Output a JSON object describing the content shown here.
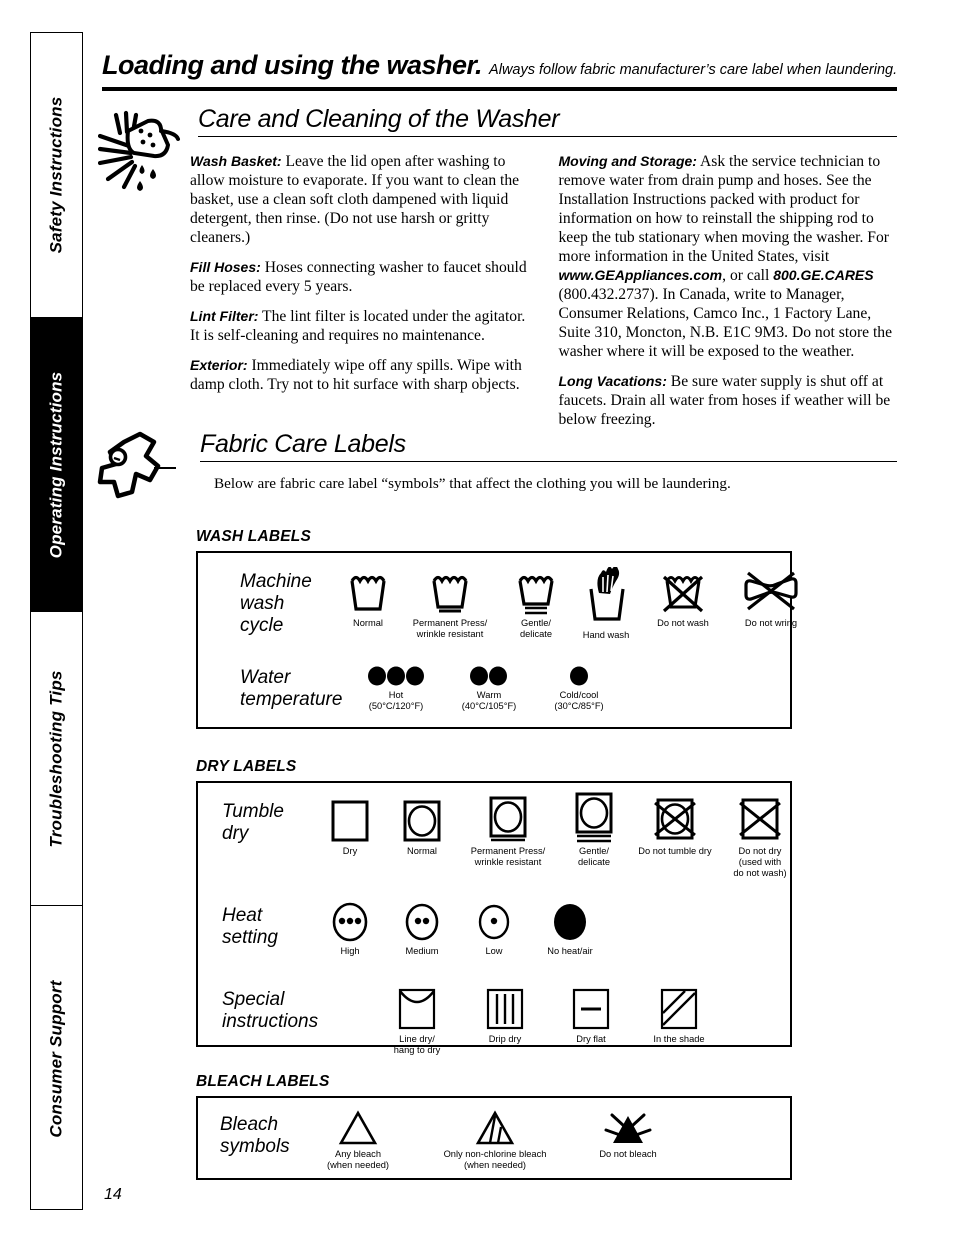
{
  "sidebar": {
    "tabs": [
      {
        "label": "Safety Instructions",
        "active": false
      },
      {
        "label": "Operating Instructions",
        "active": true
      },
      {
        "label": "Troubleshooting Tips",
        "active": false
      },
      {
        "label": "Consumer Support",
        "active": false
      }
    ]
  },
  "header": {
    "title": "Loading and using the washer.",
    "subtitle": "Always follow fabric manufacturer’s care label when laundering."
  },
  "care_section": {
    "heading": "Care and Cleaning of the Washer",
    "icon": "sponge-drip-icon",
    "left_column": [
      {
        "lead": "Wash Basket:",
        "text": " Leave the lid open after washing to allow moisture to evaporate. If you want to clean the basket, use a clean soft cloth dampened with liquid detergent, then rinse. (Do not use harsh or gritty cleaners.)"
      },
      {
        "lead": "Fill Hoses:",
        "text": " Hoses connecting washer to faucet should be replaced every 5 years."
      },
      {
        "lead": "Lint Filter:",
        "text": " The lint filter is located under the agitator. It is self-cleaning and requires no maintenance."
      },
      {
        "lead": "Exterior:",
        "text": " Immediately wipe off any spills. Wipe with damp cloth. Try not to hit surface with sharp objects."
      }
    ],
    "right_column": {
      "moving_lead": "Moving and Storage:",
      "moving_part1": " Ask the service technician to remove water from drain pump and hoses. See the Installation Instructions packed with product for information on how to reinstall the shipping rod to keep the tub stationary when moving the washer. For more information in the United States, visit ",
      "website": "www.GEAppliances.com",
      "moving_part2": ", or call ",
      "phone_word": "800.GE.CARES",
      "moving_part3": " (800.432.2737). In Canada, write to Manager, Consumer Relations, Camco Inc., 1 Factory Lane, Suite 310, Moncton, N.B. E1C 9M3. Do not store the washer where it will be exposed to the weather.",
      "vacation_lead": "Long Vacations:",
      "vacation_text": " Be sure water supply is shut off at faucets. Drain all water from hoses if weather will be below freezing."
    }
  },
  "fabric_section": {
    "heading": "Fabric Care Labels",
    "icon": "garment-person-icon",
    "intro": "Below are fabric care label “symbols” that affect the clothing you will be laundering."
  },
  "wash_labels": {
    "title": "WASH LABELS",
    "rows": [
      {
        "label": "Machine\nwash\ncycle",
        "symbols": [
          {
            "icon": "wash-tub-normal-icon",
            "caption": "Normal"
          },
          {
            "icon": "wash-tub-permanent-press-icon",
            "caption": "Permanent Press/\nwrinkle resistant"
          },
          {
            "icon": "wash-tub-gentle-icon",
            "caption": "Gentle/\ndelicate"
          },
          {
            "icon": "hand-wash-icon",
            "caption": "Hand wash"
          },
          {
            "icon": "do-not-wash-icon",
            "caption": "Do not wash"
          },
          {
            "icon": "do-not-wring-icon",
            "caption": "Do not wring"
          }
        ]
      },
      {
        "label": "Water\ntemperature",
        "symbols": [
          {
            "icon": "three-dots-icon",
            "caption": "Hot\n(50°C/120°F)"
          },
          {
            "icon": "two-dots-icon",
            "caption": "Warm\n(40°C/105°F)"
          },
          {
            "icon": "one-dot-icon",
            "caption": "Cold/cool\n(30°C/85°F)"
          }
        ]
      }
    ]
  },
  "dry_labels": {
    "title": "DRY LABELS",
    "rows": [
      {
        "label": "Tumble\ndry",
        "symbols": [
          {
            "icon": "square-dry-icon",
            "caption": "Dry"
          },
          {
            "icon": "tumble-dry-normal-icon",
            "caption": "Normal"
          },
          {
            "icon": "tumble-dry-permanent-press-icon",
            "caption": "Permanent Press/\nwrinkle resistant"
          },
          {
            "icon": "tumble-dry-gentle-icon",
            "caption": "Gentle/\ndelicate"
          },
          {
            "icon": "do-not-tumble-dry-icon",
            "caption": "Do not tumble dry"
          },
          {
            "icon": "do-not-dry-icon",
            "caption": "Do not dry\n(used with\ndo not wash)"
          }
        ]
      },
      {
        "label": "Heat\nsetting",
        "symbols": [
          {
            "icon": "heat-high-icon",
            "caption": "High"
          },
          {
            "icon": "heat-medium-icon",
            "caption": "Medium"
          },
          {
            "icon": "heat-low-icon",
            "caption": "Low"
          },
          {
            "icon": "no-heat-air-icon",
            "caption": "No heat/air"
          }
        ]
      },
      {
        "label": "Special\ninstructions",
        "symbols": [
          {
            "icon": "line-dry-icon",
            "caption": "Line dry/\nhang to dry"
          },
          {
            "icon": "drip-dry-icon",
            "caption": "Drip dry"
          },
          {
            "icon": "dry-flat-icon",
            "caption": "Dry flat"
          },
          {
            "icon": "in-the-shade-icon",
            "caption": "In the shade"
          }
        ]
      }
    ]
  },
  "bleach_labels": {
    "title": "BLEACH LABELS",
    "rows": [
      {
        "label": "Bleach\nsymbols",
        "symbols": [
          {
            "icon": "any-bleach-icon",
            "caption": "Any bleach\n(when needed)"
          },
          {
            "icon": "non-chlorine-bleach-icon",
            "caption": "Only non-chlorine bleach\n(when needed)"
          },
          {
            "icon": "do-not-bleach-icon",
            "caption": "Do not bleach"
          }
        ]
      }
    ]
  },
  "footer": {
    "page_number": "14"
  }
}
